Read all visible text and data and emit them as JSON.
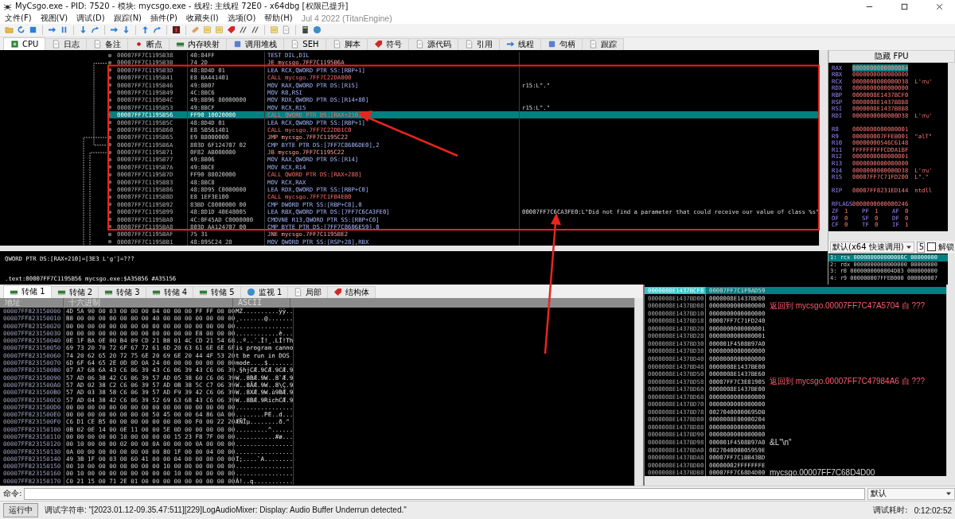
{
  "window": {
    "title": "MyCsgo.exe - PID: 7520 - 模块: mycsgo.exe - 线程: 主线程 72E0 - x64dbg [权限已提升]"
  },
  "menu": {
    "items": [
      "文件(F)",
      "视图(V)",
      "调试(D)",
      "跟踪(N)",
      "插件(P)",
      "收藏夹(I)",
      "选项(O)",
      "帮助(H)"
    ],
    "build_info": "Jul 4 2022 (TitanEngine)"
  },
  "tabs": [
    {
      "label": "CPU",
      "selected": true
    },
    {
      "label": "日志",
      "selected": false
    },
    {
      "label": "备注",
      "selected": false
    },
    {
      "label": "断点",
      "selected": false
    },
    {
      "label": "内存映射",
      "selected": false
    },
    {
      "label": "调用堆栈",
      "selected": false
    },
    {
      "label": "SEH",
      "selected": false
    },
    {
      "label": "脚本",
      "selected": false
    },
    {
      "label": "符号",
      "selected": false
    },
    {
      "label": "源代码",
      "selected": false
    },
    {
      "label": "引用",
      "selected": false
    },
    {
      "label": "线程",
      "selected": false
    },
    {
      "label": "句柄",
      "selected": false
    },
    {
      "label": "跟踪",
      "selected": false
    }
  ],
  "disassembly": {
    "rows": [
      {
        "address": "00007FF7C1195B38",
        "bytes": "40:84FF",
        "instruction": "TEST DIL,DIL",
        "kind": "plain",
        "selected": false
      },
      {
        "address": "00007FF7C1195B3B",
        "bytes": "74 2D",
        "instruction": "JE mycsgo.7FF7C1195B6A",
        "kind": "jump",
        "selected": false
      },
      {
        "address": "00007FF7C1195B3D",
        "bytes": "48:8D4D 01",
        "instruction": "LEA RCX,QWORD PTR SS:[RBP+1]",
        "kind": "plain",
        "selected": false
      },
      {
        "address": "00007FF7C1195B41",
        "bytes": "E8 BA441401",
        "instruction": "CALL mycsgo.7FF7C22DA000",
        "kind": "call",
        "selected": false
      },
      {
        "address": "00007FF7C1195B46",
        "bytes": "49:8B07",
        "instruction": "MOV RAX,QWORD PTR DS:[R15]",
        "comment": "r15:L\".\"",
        "kind": "plain",
        "selected": false
      },
      {
        "address": "00007FF7C1195B49",
        "bytes": "4C:8BC6",
        "instruction": "MOV R8,RSI",
        "kind": "plain",
        "selected": false
      },
      {
        "address": "00007FF7C1195B4C",
        "bytes": "49:8B96 80000000",
        "instruction": "MOV RDX,QWORD PTR DS:[R14+80]",
        "kind": "plain",
        "selected": false
      },
      {
        "address": "00007FF7C1195B53",
        "bytes": "49:8BCF",
        "instruction": "MOV RCX,R15",
        "comment": "r15:L\".\"",
        "kind": "plain",
        "selected": false
      },
      {
        "address": "00007FF7C1195B56",
        "bytes": "FF90 10020000",
        "instruction": "CALL QWORD PTR DS:[RAX+210]",
        "kind": "call",
        "selected": true
      },
      {
        "address": "00007FF7C1195B5C",
        "bytes": "48:8D4D 01",
        "instruction": "LEA RCX,QWORD PTR SS:[RBP+1]",
        "kind": "plain",
        "selected": false
      },
      {
        "address": "00007FF7C1195B60",
        "bytes": "E8 5B561401",
        "instruction": "CALL mycsgo.7FF7C22DB1C0",
        "kind": "call",
        "selected": false
      },
      {
        "address": "00007FF7C1195B65",
        "bytes": "E9 B8000000",
        "instruction": "JMP mycsgo.7FF7C1195C22",
        "kind": "jump",
        "selected": false
      },
      {
        "address": "00007FF7C1195B6A",
        "bytes": "803D 6F124707 02",
        "instruction": "CMP BYTE PTR DS:[7FF7C8606DE0],2",
        "kind": "plain",
        "selected": false
      },
      {
        "address": "00007FF7C1195B71",
        "bytes": "0F82 AB000000",
        "instruction": "JB mycsgo.7FF7C1195C22",
        "kind": "jump",
        "selected": false
      },
      {
        "address": "00007FF7C1195B77",
        "bytes": "49:8B06",
        "instruction": "MOV RAX,QWORD PTR DS:[R14]",
        "kind": "plain",
        "selected": false
      },
      {
        "address": "00007FF7C1195B7A",
        "bytes": "49:8BCE",
        "instruction": "MOV RCX,R14",
        "kind": "plain",
        "selected": false
      },
      {
        "address": "00007FF7C1195B7D",
        "bytes": "FF90 88020000",
        "instruction": "CALL QWORD PTR DS:[RAX+288]",
        "kind": "call",
        "selected": false
      },
      {
        "address": "00007FF7C1195B83",
        "bytes": "48:8BC8",
        "instruction": "MOV RCX,RAX",
        "kind": "plain",
        "selected": false
      },
      {
        "address": "00007FF7C1195B86",
        "bytes": "48:8D95 C0000000",
        "instruction": "LEA RDX,QWORD PTR SS:[RBP+C0]",
        "kind": "plain",
        "selected": false
      },
      {
        "address": "00007FF7C1195B8D",
        "bytes": "E8 1EF3E100",
        "instruction": "CALL mycsgo.7FF7C1FB4EB0",
        "kind": "call",
        "selected": false
      },
      {
        "address": "00007FF7C1195B92",
        "bytes": "83BD C8000000 00",
        "instruction": "CMP DWORD PTR SS:[RBP+C8],0",
        "kind": "plain",
        "selected": false
      },
      {
        "address": "00007FF7C1195B99",
        "bytes": "48:8D1D 40E48005",
        "instruction": "LEA RBX,QWORD PTR DS:[7FF7C6CA3FE0]",
        "comment": "00007FF7C6CA3FE0:L\"Did not find a parameter that could receive our value of class %s\"",
        "kind": "plain",
        "selected": false
      },
      {
        "address": "00007FF7C1195BA0",
        "bytes": "4C:0F45AD C0000000",
        "instruction": "CMOVNE R13,QWORD PTR SS:[RBP+C0]",
        "kind": "plain",
        "selected": false
      },
      {
        "address": "00007FF7C1195BA8",
        "bytes": "803D AA124707 00",
        "instruction": "CMP BYTE PTR DS:[7FF7C8606E59],0",
        "kind": "plain",
        "selected": false
      },
      {
        "address": "00007FF7C1195BAF",
        "bytes": "75 31",
        "instruction": "JNE mycsgo.7FF7C1195BE2",
        "kind": "jump",
        "selected": false
      },
      {
        "address": "00007FF7C1195BB1",
        "bytes": "48:895C24 28",
        "instruction": "MOV QWORD PTR SS:[RSP+28],RBX",
        "kind": "plain",
        "selected": false
      }
    ]
  },
  "info": {
    "lines": [
      "QWORD PTR DS:[RAX+210]=[3E3 L'g']=???",
      ".text:00007FF7C1195B56 mycsgo.exe:$A35B56 #A35156"
    ]
  },
  "registers": {
    "header": "隐藏 FPU",
    "groups": [
      [
        {
          "name": "RAX",
          "value": "0000000000000084",
          "selected": true
        },
        {
          "name": "RBX",
          "value": "0000000000000000",
          "selected": false
        },
        {
          "name": "RCX",
          "value": "0000000000000D38",
          "comment": "L'സ'",
          "selected": false
        },
        {
          "name": "RDX",
          "value": "0000000000000000",
          "selected": false
        },
        {
          "name": "RBP",
          "value": "0000008E1437BCF0",
          "selected": false
        },
        {
          "name": "RSP",
          "value": "0000008E1437B8B8",
          "selected": false
        },
        {
          "name": "RSI",
          "value": "0000008E1437B8B8",
          "selected": false
        },
        {
          "name": "RDI",
          "value": "0000000000000D38",
          "comment": "L'സ'",
          "selected": false
        }
      ],
      [
        {
          "name": "R8",
          "value": "0000000000000001",
          "selected": false
        },
        {
          "name": "R9",
          "value": "000000007FFEB001",
          "comment": "\"alT\"",
          "selected": false
        },
        {
          "name": "R10",
          "value": "00000000546C6148",
          "selected": false
        },
        {
          "name": "R11",
          "value": "FFFFFFFFFCDDA1BF",
          "selected": false
        },
        {
          "name": "R12",
          "value": "0000000000000001",
          "selected": false
        },
        {
          "name": "R13",
          "value": "0000000000000000",
          "selected": false
        },
        {
          "name": "R14",
          "value": "0000000000000D38",
          "comment": "L'സ'",
          "selected": false
        },
        {
          "name": "R15",
          "value": "00007FF7C71FD200",
          "comment": "L\".\"",
          "selected": false
        }
      ],
      [
        {
          "name": "RIP",
          "value": "00007FF8231ED144",
          "comment": "ntdll",
          "selected": false
        }
      ]
    ],
    "rflags": {
      "name": "RFLAGS",
      "value": "0000000000000246"
    },
    "flags": [
      [
        {
          "name": "ZF",
          "value": "1"
        },
        {
          "name": "PF",
          "value": "1"
        },
        {
          "name": "AF",
          "value": "0"
        }
      ],
      [
        {
          "name": "OF",
          "value": "0"
        },
        {
          "name": "SF",
          "value": "0"
        },
        {
          "name": "DF",
          "value": "0"
        }
      ],
      [
        {
          "name": "CF",
          "value": "0"
        },
        {
          "name": "TF",
          "value": "0"
        },
        {
          "name": "IF",
          "value": "1"
        }
      ]
    ]
  },
  "call_args": {
    "convention": "默认(x64 快速调用)",
    "count": "5",
    "unlock": {
      "label": "解锁",
      "checked": false
    },
    "rows": [
      {
        "text": "1: rcx 000000000000086C 00000000",
        "selected": true
      },
      {
        "text": "2: rdx 0000000000000000 00000000",
        "selected": false
      },
      {
        "text": "3: r8 0000000000004D83 000000000",
        "selected": false
      },
      {
        "text": "4: r9 000000007FFEB000 000000007",
        "selected": false
      }
    ]
  },
  "dump": {
    "tabs": [
      {
        "label": "转储 1",
        "selected": true
      },
      {
        "label": "转储 2",
        "selected": false
      },
      {
        "label": "转储 3",
        "selected": false
      },
      {
        "label": "转储 4",
        "selected": false
      },
      {
        "label": "转储 5",
        "selected": false
      },
      {
        "label": "监视 1",
        "selected": false
      },
      {
        "label": "局部",
        "selected": false
      },
      {
        "label": "结构体",
        "selected": false
      }
    ],
    "columns": [
      "地址",
      "十六进制",
      "ASCII"
    ],
    "rows": [
      {
        "address": "00007FF823150000",
        "hex": "4D 5A 90 00 03 00 00 00 04 00 00 00 FF FF 00 00",
        "ascii": "MZ..........ÿÿ.."
      },
      {
        "address": "00007FF823150010",
        "hex": "B8 00 00 00 00 00 00 00 40 00 00 00 00 00 00 00",
        "ascii": "¸.......@......."
      },
      {
        "address": "00007FF823150020",
        "hex": "00 00 00 00 00 00 00 00 00 00 00 00 00 00 00 00",
        "ascii": "................"
      },
      {
        "address": "00007FF823150030",
        "hex": "00 00 00 00 00 00 00 00 00 00 00 00 E8 00 00 00",
        "ascii": "............è..."
      },
      {
        "address": "00007FF823150040",
        "hex": "0E 1F BA 0E 00 B4 09 CD 21 B8 01 4C CD 21 54 68",
        "ascii": "..º..´.Í!¸.LÍ!Th"
      },
      {
        "address": "00007FF823150050",
        "hex": "69 73 20 70 72 6F 67 72 61 6D 20 63 61 6E 6E 6F",
        "ascii": "is program canno"
      },
      {
        "address": "00007FF823150060",
        "hex": "74 20 62 65 20 72 75 6E 20 69 6E 20 44 4F 53 20",
        "ascii": "t be run in DOS "
      },
      {
        "address": "00007FF823150070",
        "hex": "6D 6F 64 65 2E 0D 0D 0A 24 00 00 00 00 00 00 00",
        "ascii": "mode....$......."
      },
      {
        "address": "00007FF823150080",
        "hex": "07 A7 68 6A 43 C6 06 39 43 C6 06 39 43 C6 06 39",
        "ascii": ".§hjCÆ.9CÆ.9CÆ.9"
      },
      {
        "address": "00007FF823150090",
        "hex": "57 AD 06 38 42 C6 06 39 57 AD 05 38 60 C6 06 39",
        "ascii": "W..8BÆ.9W..8`Æ.9"
      },
      {
        "address": "00007FF8231500A0",
        "hex": "57 AD 02 38 C2 C6 06 39 57 AD 0B 38 5C C7 06 39",
        "ascii": "W..8ÂÆ.9W..8\\Ç.9"
      },
      {
        "address": "00007FF8231500B0",
        "hex": "57 AD 03 38 58 C6 06 39 57 AD F9 39 42 C6 06 39",
        "ascii": "W..8XÆ.9W.ù9BÆ.9"
      },
      {
        "address": "00007FF8231500C0",
        "hex": "57 AD 04 38 42 C6 06 39 52 69 63 68 43 C6 06 39",
        "ascii": "W..8BÆ.9RichCÆ.9"
      },
      {
        "address": "00007FF8231500D0",
        "hex": "00 00 00 00 00 00 00 00 00 00 00 00 00 00 00 00",
        "ascii": "................"
      },
      {
        "address": "00007FF8231500E0",
        "hex": "00 00 00 00 00 00 00 00 50 45 00 00 64 86 0A 00",
        "ascii": "........PE..d..."
      },
      {
        "address": "00007FF8231500F0",
        "hex": "C6 D1 CE B5 00 00 00 00 00 00 00 00 F0 00 22 20",
        "ascii": "ÆÑÎµ........ð.\" "
      },
      {
        "address": "00007FF823150100",
        "hex": "0B 02 0E 14 00 0E 11 00 00 5E 0D 00 00 00 00 00",
        "ascii": ".........^......"
      },
      {
        "address": "00007FF823150110",
        "hex": "00 00 00 00 00 10 00 00 00 00 15 23 F8 7F 00 00",
        "ascii": "...........#ø..."
      },
      {
        "address": "00007FF823150120",
        "hex": "00 10 00 00 00 02 00 00 0A 00 00 00 0A 00 00 00",
        "ascii": "................"
      },
      {
        "address": "00007FF823150130",
        "hex": "0A 00 00 00 00 00 00 00 00 80 1F 00 00 04 00 00",
        "ascii": "................"
      },
      {
        "address": "00007FF823150140",
        "hex": "49 3B 1F 00 03 00 60 41 00 00 04 00 00 00 00 00",
        "ascii": "I;....`A........"
      },
      {
        "address": "00007FF823150150",
        "hex": "00 10 00 00 00 00 00 00 00 10 00 00 00 00 00 00",
        "ascii": "................"
      },
      {
        "address": "00007FF823150160",
        "hex": "00 10 00 00 00 00 00 00 00 00 10 00 00 00 00 00",
        "ascii": "................"
      },
      {
        "address": "00007FF823150170",
        "hex": "C0 21 15 00 71 2E 01 00 00 00 00 00 00 00 00 00",
        "ascii": "À!..q..........."
      }
    ]
  },
  "stack": {
    "rows": [
      {
        "address": "0000008E1437BCF8",
        "value": "00007FF7C1F9AD59",
        "selected": true
      },
      {
        "address": "0000008E1437BD00",
        "value": "0000008E1437BD00",
        "selected": false
      },
      {
        "address": "0000008E1437BD08",
        "value": "0000000000000000",
        "comment": "返回到 mycsgo.00007FF7C47A5704 自 ???",
        "kind": "return",
        "selected": false
      },
      {
        "address": "0000008E1437BD10",
        "value": "0000000000000000",
        "selected": false
      },
      {
        "address": "0000008E1437BD18",
        "value": "00007FF7C71FD240",
        "selected": false
      },
      {
        "address": "0000008E1437BD20",
        "value": "0000000000000001",
        "selected": false
      },
      {
        "address": "0000008E1437BD28",
        "value": "0000000000000001",
        "selected": false
      },
      {
        "address": "0000008E1437BD30",
        "value": "000001F4508B97A0",
        "selected": false
      },
      {
        "address": "0000008E1437BD38",
        "value": "0000000000000000",
        "selected": false
      },
      {
        "address": "0000008E1437BD40",
        "value": "0000000000000000",
        "selected": false
      },
      {
        "address": "0000008E1437BD48",
        "value": "0000008E1437BE00",
        "selected": false
      },
      {
        "address": "0000008E1437BD50",
        "value": "0000008E1437BE60",
        "selected": false
      },
      {
        "address": "0000008E1437BD58",
        "value": "00007FF7C3E81905",
        "comment": "返回到 mycsgo.00007FF7C47984A6 自 ???",
        "kind": "return",
        "selected": false
      },
      {
        "address": "0000008E1437BD60",
        "value": "0000008E1437BE00",
        "selected": false
      },
      {
        "address": "0000008E1437BD68",
        "value": "0000000000000000",
        "selected": false
      },
      {
        "address": "0000008E1437BD70",
        "value": "0000000000000000",
        "selected": false
      },
      {
        "address": "0000008E1437BD78",
        "value": "00270400000695DB",
        "selected": false
      },
      {
        "address": "0000008E1437BD80",
        "value": "0000008E00000204",
        "selected": false
      },
      {
        "address": "0000008E1437BD88",
        "value": "0000000000000000",
        "selected": false
      },
      {
        "address": "0000008E1437BD90",
        "value": "0000000000000000",
        "selected": false
      },
      {
        "address": "0000008E1437BD98",
        "value": "000001F4508B97A0",
        "comment": "&L\"\\n\"",
        "kind": "data",
        "selected": false
      },
      {
        "address": "0000008E1437BDA0",
        "value": "002704000005959E",
        "selected": false
      },
      {
        "address": "0000008E1437BDA8",
        "value": "00007FF7C1BB43BD",
        "selected": false
      },
      {
        "address": "0000008E1437BDB0",
        "value": "00000002FFFFFFFE",
        "selected": false
      },
      {
        "address": "0000008E1437BDB8",
        "value": "00007FF7C68D4D00",
        "comment": "mycsgo.00007FF7C68D4D00",
        "kind": "data",
        "selected": false
      }
    ]
  },
  "command": {
    "label": "命令:",
    "mode": "默认"
  },
  "status": {
    "state": "运行中",
    "message": "调试字符串: \"[2023.01.12-09.35.47:511][229]LogAudioMixer: Display: Audio Buffer Underrun detected.\"",
    "timer_label": "调试耗时:",
    "timer": "0:12:02:52"
  }
}
